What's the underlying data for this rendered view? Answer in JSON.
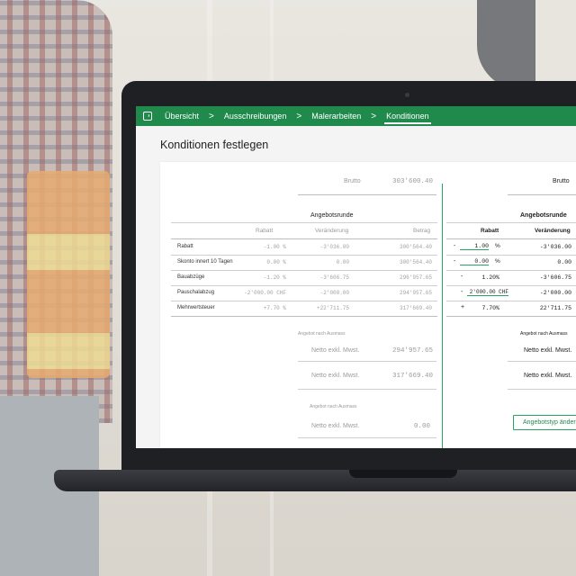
{
  "nav": {
    "items": [
      "Übersicht",
      "Ausschreibungen",
      "Malerarbeiten",
      "Konditionen"
    ],
    "separator": ">"
  },
  "page_title": "Konditionen festlegen",
  "left": {
    "brutto_label": "Brutto",
    "brutto_value": "303'600.40",
    "section_title": "Angebotsrunde",
    "headers": [
      "Rabatt",
      "Veränderung",
      "Betrag"
    ],
    "rows": [
      {
        "label": "Rabatt",
        "rabatt": "-1.00 %",
        "veraenderung": "-3'036.00",
        "betrag": "300'564.40"
      },
      {
        "label": "Skonto innert 10 Tagen",
        "rabatt": "0.00 %",
        "veraenderung": "0.00",
        "betrag": "300'564.40"
      },
      {
        "label": "Bauabzüge",
        "rabatt": "-1.20 %",
        "veraenderung": "-3'606.75",
        "betrag": "296'957.65"
      },
      {
        "label": "Pauschalabzug",
        "rabatt": "-2'000.00 CHF",
        "veraenderung": "-2'000.00",
        "betrag": "294'957.65"
      },
      {
        "label": "Mehrwertsteuer",
        "rabatt": "+7.70 %",
        "veraenderung": "+22'711.75",
        "betrag": "317'669.40"
      }
    ],
    "angebot_label_1": "Angebot nach Ausmass",
    "netto1_label": "Netto exkl. Mwst.",
    "netto1_value": "294'957.65",
    "netto2_label": "Netto exkl. Mwst.",
    "netto2_value": "317'669.40",
    "angebot_label_2": "Angebot nach Ausmass",
    "netto3_label": "Netto exkl. Mwst.",
    "netto3_value": "0.00"
  },
  "right": {
    "brutto_label": "Brutto",
    "section_title": "Angebotsrunde",
    "headers": [
      "Rabatt",
      "Veränderung"
    ],
    "rows": [
      {
        "sign": "-",
        "value": "1.00",
        "unit": "%",
        "veraenderung": "-3'036.00"
      },
      {
        "sign": "-",
        "value": "0.00",
        "unit": "%",
        "veraenderung": "0.00"
      },
      {
        "sign": "-",
        "value": "1.20%",
        "unit": "",
        "veraenderung": "-3'606.75"
      },
      {
        "sign": "-",
        "value": "2'000.00 CHF",
        "unit": "",
        "veraenderung": "-2'000.00"
      },
      {
        "sign": "+",
        "value": "7.70%",
        "unit": "",
        "veraenderung": "22'711.75"
      }
    ],
    "angebot_label": "Angebot nach Ausmass",
    "netto1_label": "Netto exkl. Mwst.",
    "netto2_label": "Netto exkl. Mwst.",
    "button_label": "Angebotstyp ändern"
  },
  "colors": {
    "brand": "#1f8a4c",
    "accent_line": "#25a562"
  }
}
